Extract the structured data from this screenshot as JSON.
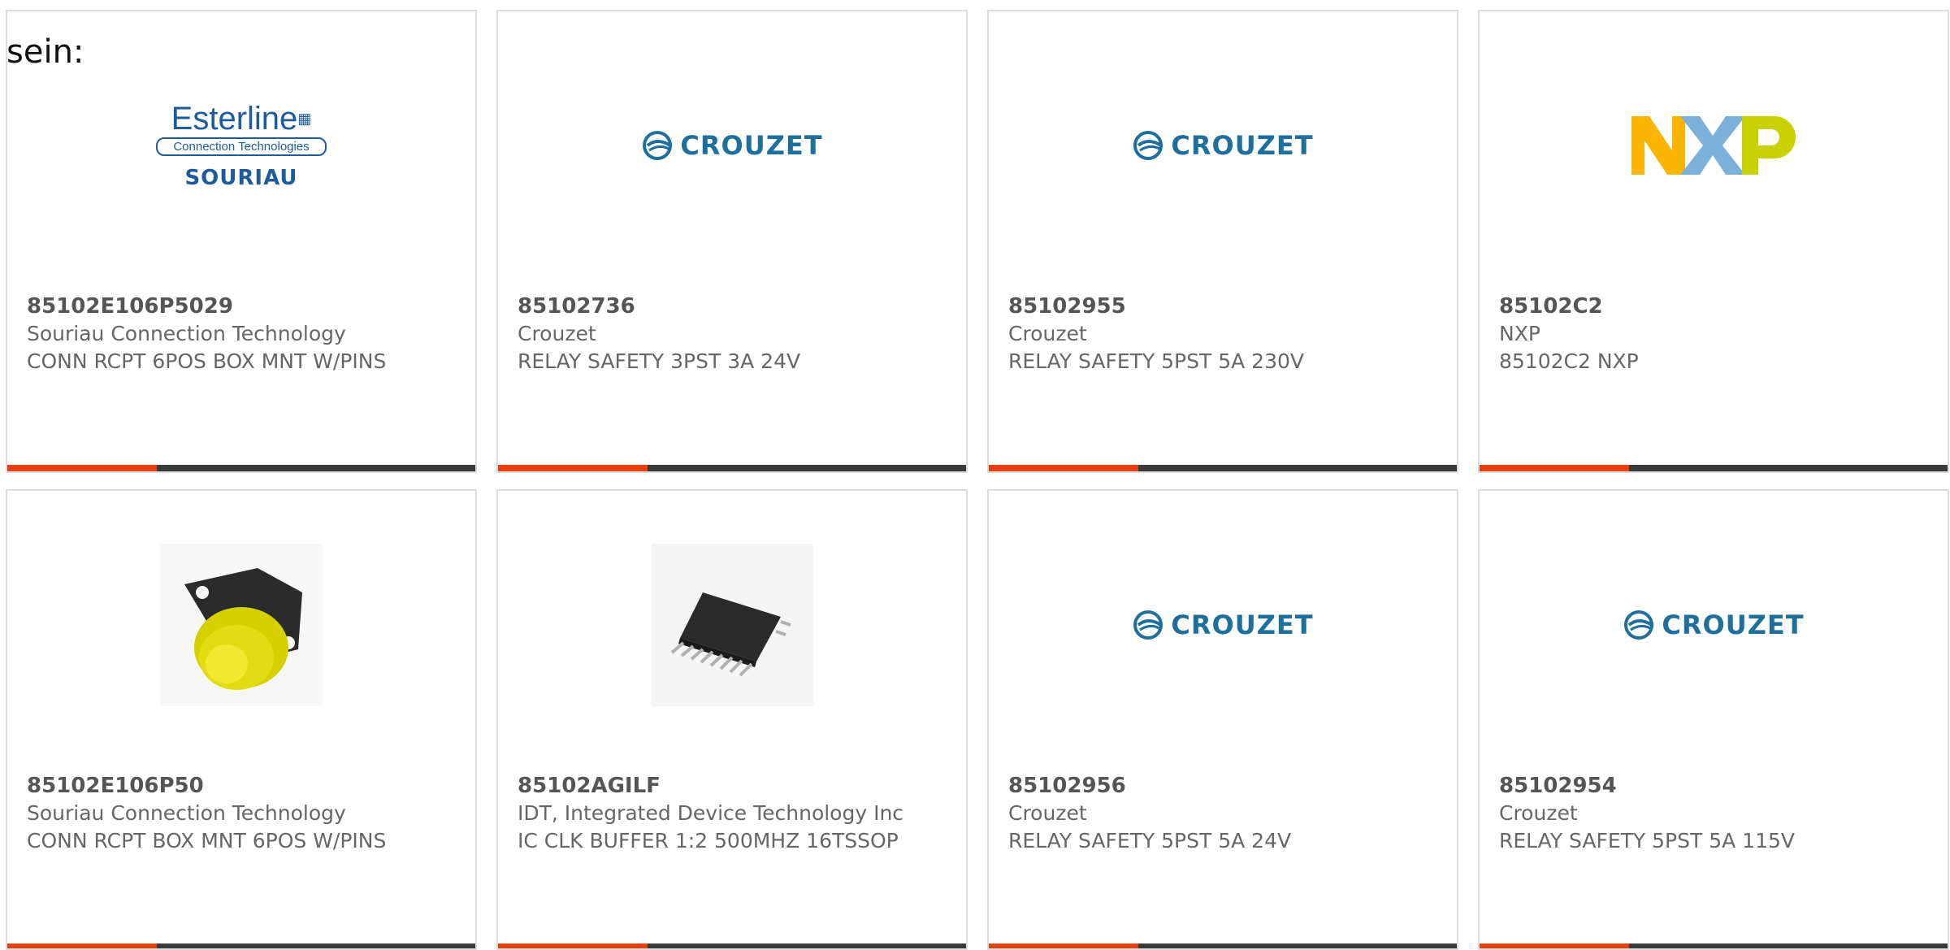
{
  "intro_text": "sein:",
  "products": [
    {
      "part_number": "85102E106P5029",
      "manufacturer": "Souriau Connection Technology",
      "description": "CONN RCPT 6POS BOX MNT W/PINS",
      "image": "esterline-souriau-logo"
    },
    {
      "part_number": "85102736",
      "manufacturer": "Crouzet",
      "description": "RELAY SAFETY 3PST 3A 24V",
      "image": "crouzet-logo"
    },
    {
      "part_number": "85102955",
      "manufacturer": "Crouzet",
      "description": "RELAY SAFETY 5PST 5A 230V",
      "image": "crouzet-logo"
    },
    {
      "part_number": "85102C2",
      "manufacturer": "NXP",
      "description": "85102C2 NXP",
      "image": "nxp-logo"
    },
    {
      "part_number": "85102E106P50",
      "manufacturer": "Souriau Connection Technology",
      "description": "CONN RCPT BOX MNT 6POS W/PINS",
      "image": "connector-photo"
    },
    {
      "part_number": "85102AGILF",
      "manufacturer": "IDT, Integrated Device Technology Inc",
      "description": "IC CLK BUFFER 1:2 500MHZ 16TSSOP",
      "image": "chip-photo"
    },
    {
      "part_number": "85102956",
      "manufacturer": "Crouzet",
      "description": "RELAY SAFETY 5PST 5A 24V",
      "image": "crouzet-logo"
    },
    {
      "part_number": "85102954",
      "manufacturer": "Crouzet",
      "description": "RELAY SAFETY 5PST 5A 115V",
      "image": "crouzet-logo"
    }
  ],
  "logos": {
    "esterline_brand": "Esterline",
    "esterline_sub": "Connection Technologies",
    "souriau": "SOURIAU",
    "crouzet": "CROUZET"
  },
  "colors": {
    "accent": "#e8400c",
    "bar": "#3a3a3a",
    "crouzet_blue": "#1f6f9d",
    "esterline_blue": "#1d5b9a",
    "nxp_yellow": "#f9b500",
    "nxp_blue": "#7bb1db",
    "nxp_green": "#c9d200"
  }
}
